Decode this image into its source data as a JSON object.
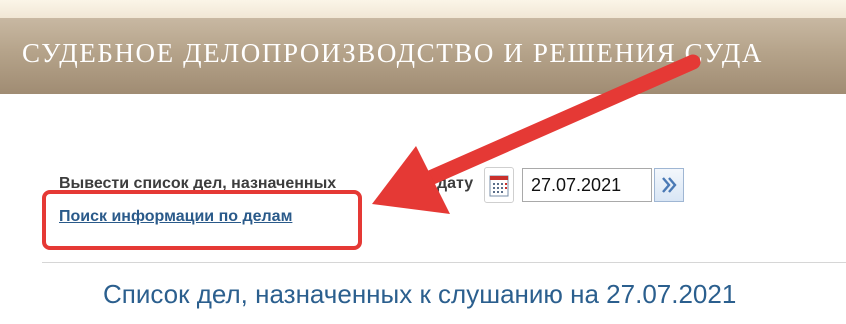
{
  "header": {
    "title": "СУДЕБНОЕ ДЕЛОПРОИЗВОДСТВО И РЕШЕНИЯ СУДА"
  },
  "date_filter": {
    "label_start": "Вывести список дел, назначенных",
    "label_end": "дату",
    "value": "27.07.2021",
    "calendar_icon": "calendar-icon",
    "go_icon": "double-chevron-right-icon"
  },
  "search_link": {
    "label": "Поиск информации по делам"
  },
  "list_heading": "Список дел, назначенных к слушанию на 27.07.2021",
  "colors": {
    "banner": "#b5a38a",
    "link": "#2a5a8a",
    "heading": "#2b5f8e",
    "annotation": "#e53935"
  }
}
